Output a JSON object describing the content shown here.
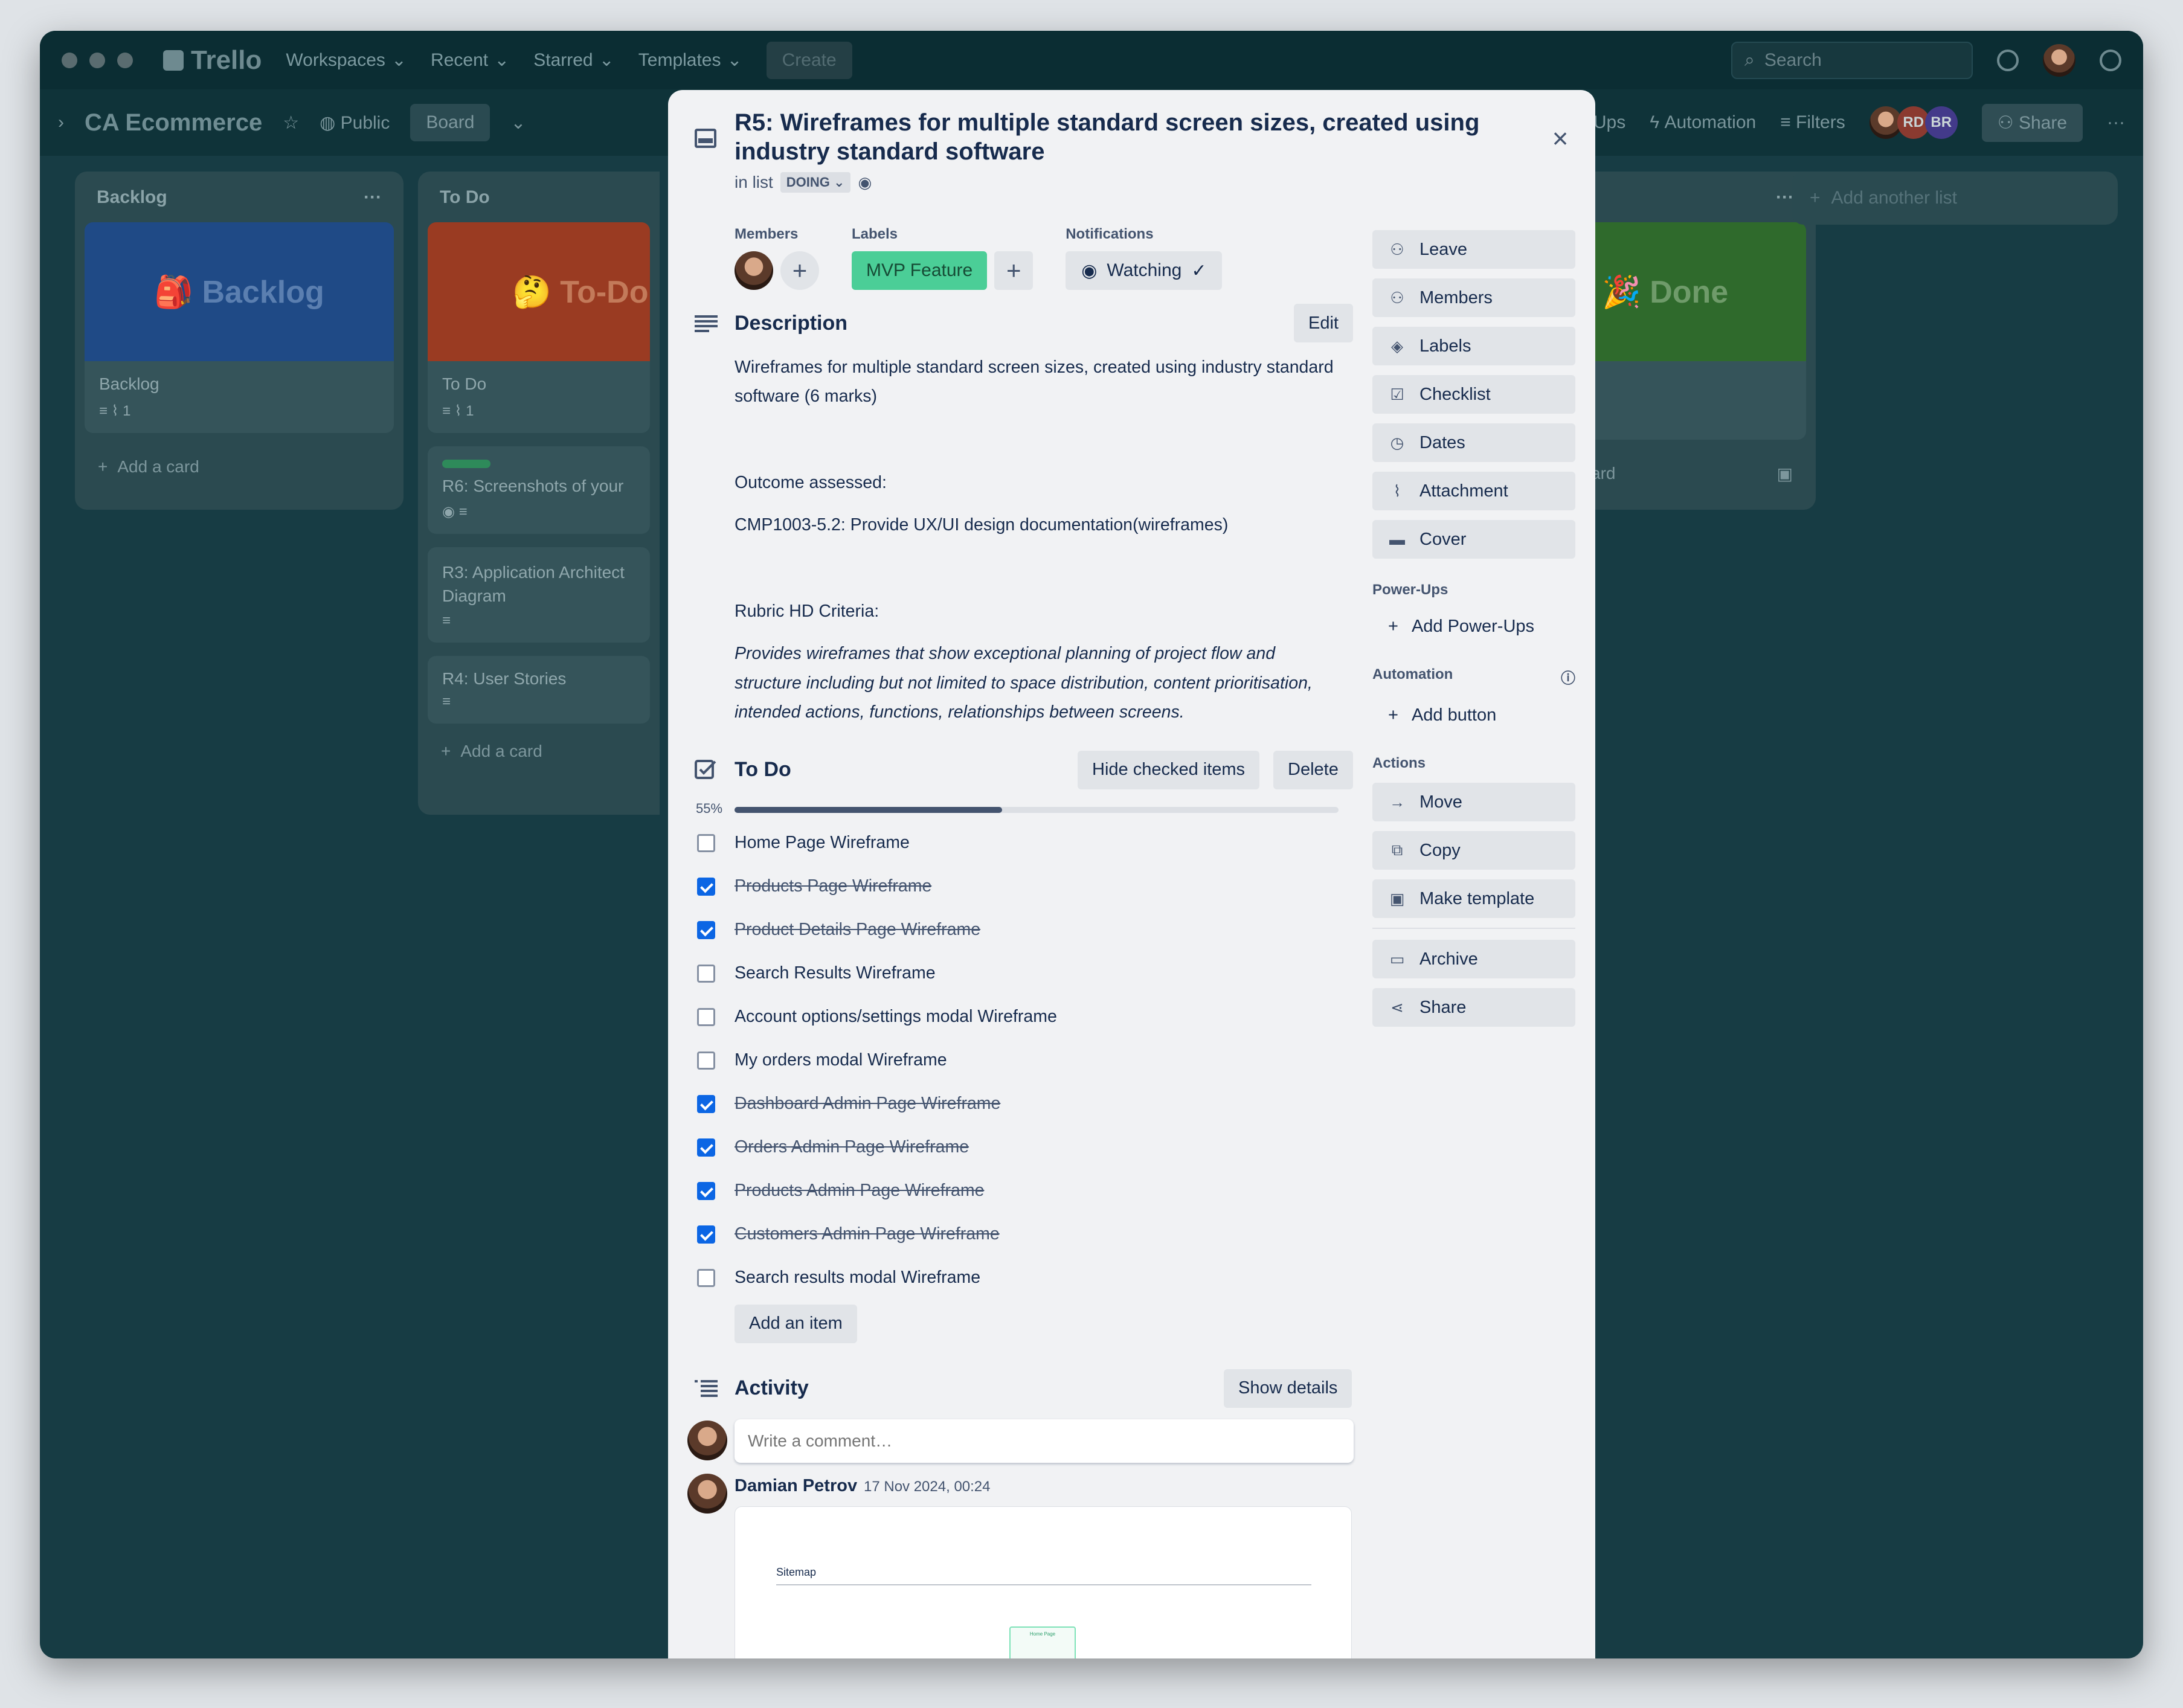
{
  "topbar": {
    "logo": "Trello",
    "nav": [
      "Workspaces",
      "Recent",
      "Starred",
      "Templates"
    ],
    "create": "Create",
    "search_placeholder": "Search"
  },
  "board": {
    "title": "CA Ecommerce",
    "visibility": "Public",
    "view": "Board",
    "powerups": "Power-Ups",
    "automation": "Automation",
    "filters": "Filters",
    "members": [
      "RD",
      "BR"
    ],
    "share": "Share",
    "add_list": "Add another list"
  },
  "lists": {
    "backlog": {
      "title": "Backlog",
      "cover": "🎒 Backlog",
      "card": "Backlog",
      "attach_count": "1",
      "add": "Add a card"
    },
    "todo": {
      "title": "To Do",
      "cover": "🤔 To-Do",
      "card": "To Do",
      "attach_count": "1",
      "cards": [
        "R6: Screenshots of your",
        "R3: Application Architect Diagram",
        "R4: User Stories"
      ],
      "add": "Add a card"
    },
    "done": {
      "cover": "🎉 Done",
      "add": "ard"
    }
  },
  "modal": {
    "title": "R5: Wireframes for multiple standard screen sizes, created using industry standard software",
    "in_list_prefix": "in list",
    "list_name": "DOING",
    "members_label": "Members",
    "labels_label": "Labels",
    "label_text": "MVP Feature",
    "notifications_label": "Notifications",
    "watching": "Watching",
    "description": {
      "title": "Description",
      "edit": "Edit",
      "p1": "Wireframes for multiple standard screen sizes, created using industry standard software (6 marks)",
      "p2": "Outcome assessed:",
      "p3": "CMP1003-5.2: Provide UX/UI design documentation(wireframes)",
      "p4": "Rubric HD Criteria:",
      "p5": "Provides wireframes that show exceptional planning of project flow and structure including but not limited to space distribution, content prioritisation, intended actions, functions, relationships between screens."
    },
    "checklist": {
      "title": "To Do",
      "hide_checked": "Hide checked items",
      "delete": "Delete",
      "percent_label": "55%",
      "progress": 0.55,
      "items": [
        {
          "text": "Home Page Wireframe",
          "done": false
        },
        {
          "text": "Products Page Wireframe",
          "done": true
        },
        {
          "text": "Product Details Page Wireframe",
          "done": true
        },
        {
          "text": "Search Results Wireframe",
          "done": false
        },
        {
          "text": "Account options/settings modal Wireframe",
          "done": false
        },
        {
          "text": "My orders modal Wireframe",
          "done": false
        },
        {
          "text": "Dashboard Admin Page Wireframe",
          "done": true
        },
        {
          "text": "Orders Admin Page Wireframe",
          "done": true
        },
        {
          "text": "Products Admin Page Wireframe",
          "done": true
        },
        {
          "text": "Customers Admin Page Wireframe",
          "done": true
        },
        {
          "text": "Search results modal Wireframe",
          "done": false
        }
      ],
      "add_item": "Add an item"
    },
    "activity": {
      "title": "Activity",
      "show_details": "Show details",
      "comment_placeholder": "Write a comment…",
      "author": "Damian Petrov",
      "time": "17 Nov 2024, 00:24",
      "attachment_heading": "Sitemap",
      "attachment_box": "Home Page"
    },
    "sidebar": {
      "buttons": [
        "Leave",
        "Members",
        "Labels",
        "Checklist",
        "Dates",
        "Attachment",
        "Cover"
      ],
      "powerups_head": "Power-Ups",
      "add_powerups": "Add Power-Ups",
      "automation_head": "Automation",
      "add_button": "Add button",
      "actions_head": "Actions",
      "actions": [
        "Move",
        "Copy",
        "Make template"
      ],
      "actions2": [
        "Archive",
        "Share"
      ]
    }
  },
  "colors": {
    "backlog_cover": "#1f4a86",
    "todo_cover": "#9a3b22",
    "done_cover": "#2f6a2c",
    "label_green": "#4bce97",
    "checkbox_blue": "#0c66e4"
  }
}
